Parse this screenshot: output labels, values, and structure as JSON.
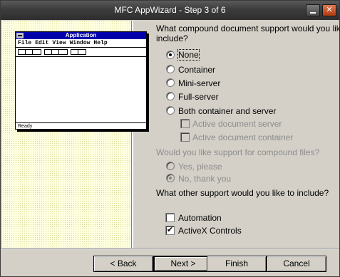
{
  "window": {
    "title": "MFC AppWizard - Step 3 of 6"
  },
  "preview": {
    "app_title": "Application",
    "menu": [
      "File",
      "Edit",
      "View",
      "Window",
      "Help"
    ],
    "status": "Ready"
  },
  "compound": {
    "question_line1": "What compound document support would you like to",
    "question_line2": "include?",
    "options": [
      "None",
      "Container",
      "Mini-server",
      "Full-server",
      "Both container and server"
    ],
    "selected": "None",
    "sub_options": [
      "Active document server",
      "Active document container"
    ]
  },
  "files": {
    "question": "Would you like support for compound files?",
    "options": [
      "Yes, please",
      "No, thank you"
    ],
    "selected": "No, thank you"
  },
  "other": {
    "question": "What other support would you like to include?",
    "options": [
      {
        "label": "Automation",
        "checked": false
      },
      {
        "label": "ActiveX Controls",
        "checked": true
      }
    ]
  },
  "buttons": {
    "back": "< Back",
    "next": "Next >",
    "finish": "Finish",
    "cancel": "Cancel"
  }
}
